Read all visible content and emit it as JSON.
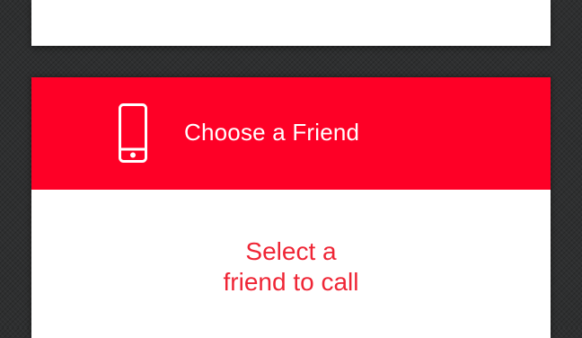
{
  "colors": {
    "accent_red": "#fe0026",
    "prompt_red": "#ef2535",
    "background": "#2e2f30",
    "card": "#ffffff"
  },
  "friend_card": {
    "header": {
      "icon": "phone-icon",
      "title": "Choose a Friend"
    },
    "prompt": {
      "line1": "Select a",
      "line2": "friend to call"
    }
  }
}
